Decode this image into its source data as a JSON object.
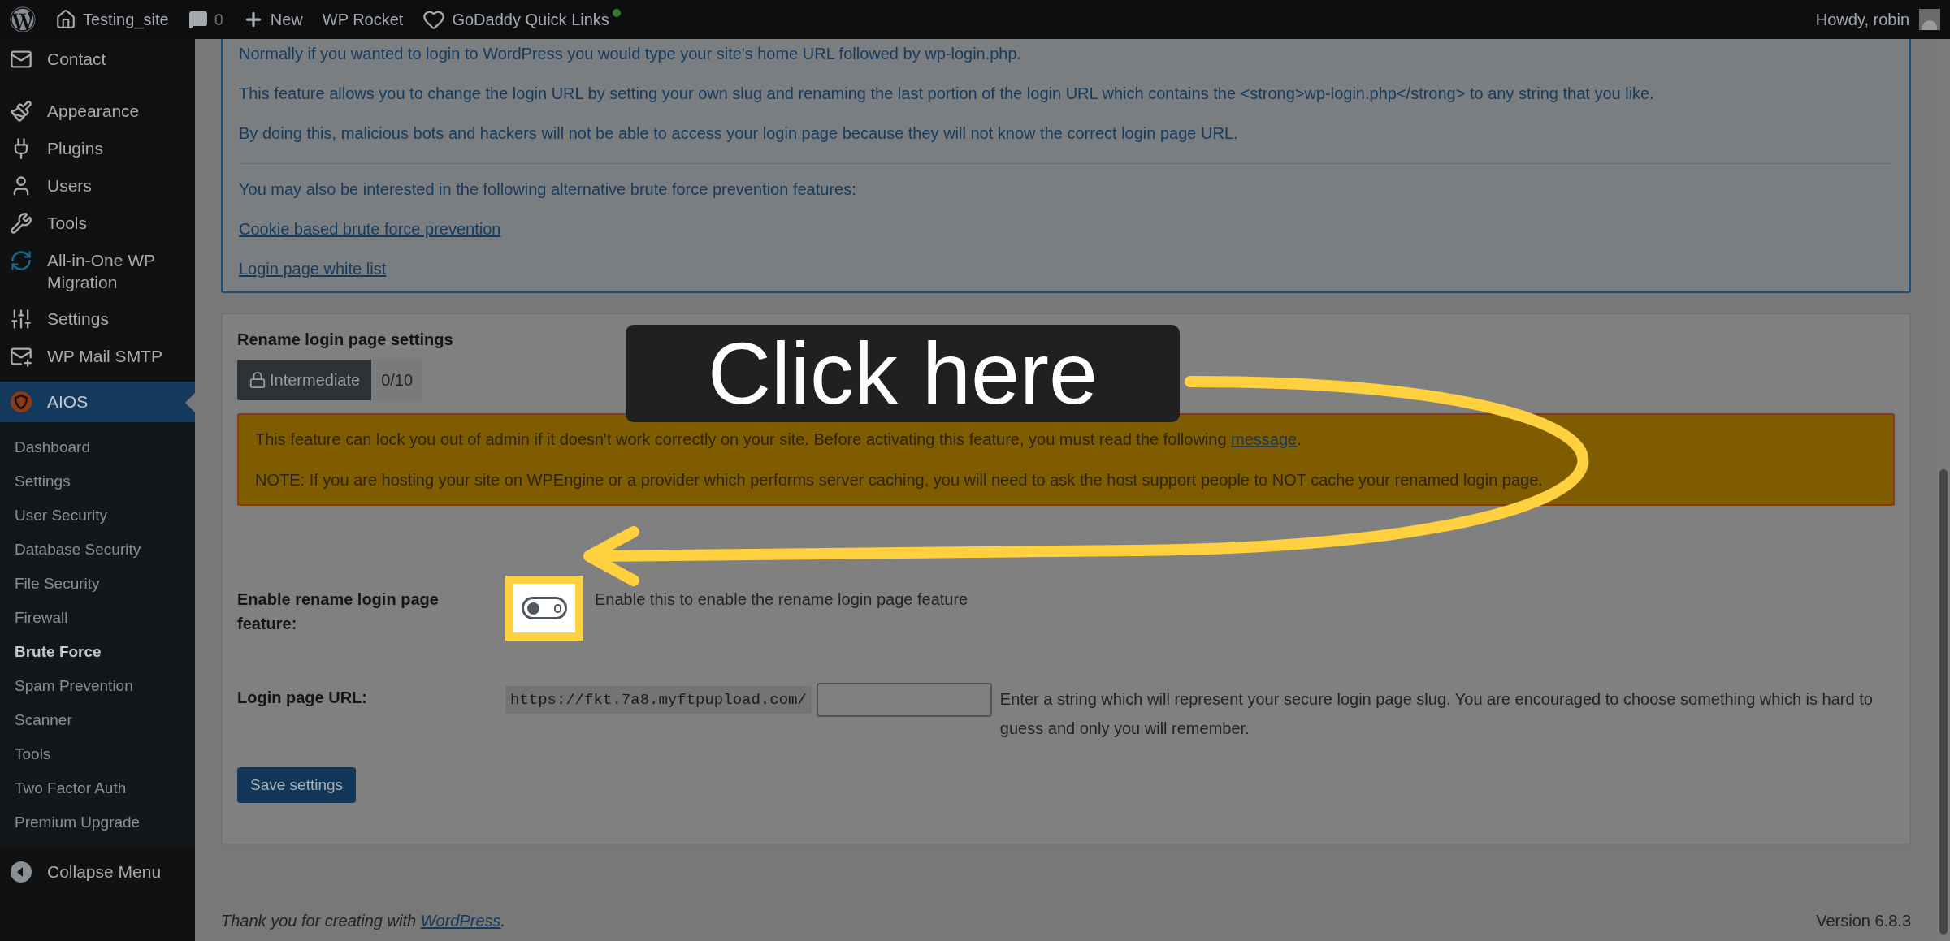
{
  "admin_bar": {
    "items": [
      {
        "kind": "logo"
      },
      {
        "kind": "site",
        "label": "Testing_site"
      },
      {
        "kind": "comments",
        "label": "0"
      },
      {
        "kind": "new",
        "label": "New"
      },
      {
        "kind": "text",
        "label": "WP Rocket"
      },
      {
        "kind": "godaddy",
        "label": "GoDaddy Quick Links"
      }
    ],
    "account": "Howdy, robin"
  },
  "sidebar": {
    "items": [
      {
        "label": "Contact",
        "selected": false
      },
      {
        "label": "Appearance",
        "selected": false
      },
      {
        "label": "Plugins",
        "selected": false
      },
      {
        "label": "Users",
        "selected": false
      },
      {
        "label": "Tools",
        "selected": false
      },
      {
        "label": "All-in-One WP Migration",
        "selected": false
      },
      {
        "label": "Settings",
        "selected": false
      },
      {
        "label": "WP Mail SMTP",
        "selected": false
      },
      {
        "label": "AIOS",
        "selected": true
      }
    ],
    "submenu": [
      {
        "label": "Dashboard",
        "selected": false
      },
      {
        "label": "Settings",
        "selected": false
      },
      {
        "label": "User Security",
        "selected": false
      },
      {
        "label": "Database Security",
        "selected": false
      },
      {
        "label": "File Security",
        "selected": false
      },
      {
        "label": "Firewall",
        "selected": false
      },
      {
        "label": "Brute Force",
        "selected": true
      },
      {
        "label": "Spam Prevention",
        "selected": false
      },
      {
        "label": "Scanner",
        "selected": false
      },
      {
        "label": "Tools",
        "selected": false
      },
      {
        "label": "Two Factor Auth",
        "selected": false
      },
      {
        "label": "Premium Upgrade",
        "selected": false
      }
    ],
    "collapse": "Collapse Menu"
  },
  "info_box": {
    "paragraphs": [
      "Normally if you wanted to login to WordPress you would type your site's home URL followed by wp-login.php.",
      "This feature allows you to change the login URL by setting your own slug and renaming the last portion of the login URL which contains the <strong>wp-login.php</strong> to any string that you like.",
      "By doing this, malicious bots and hackers will not be able to access your login page because they will not know the correct login page URL."
    ],
    "alternatives_intro": "You may also be interested in the following alternative brute force prevention features:",
    "links": [
      "Cookie based brute force prevention",
      "Login page white list"
    ]
  },
  "settings": {
    "title": "Rename login page settings",
    "badge": {
      "label": "Intermediate",
      "score": "0/10"
    },
    "warning": {
      "before": "This feature can lock you out of admin if it doesn't work correctly on your site. Before activating this feature, you must read the following ",
      "link": "message",
      "after": ".",
      "note": "NOTE: If you are hosting your site on WPEngine or a provider which performs server caching, you will need to ask the host support people to NOT cache your renamed login page."
    },
    "toggle": {
      "label": "Enable rename login page feature:",
      "on": false,
      "description": "Enable this to enable the rename login page feature"
    },
    "url": {
      "label": "Login page URL:",
      "prefix": "https://fkt.7a8.myftpupload.com/",
      "help": "Enter a string which will represent your secure login page slug. You are encouraged to choose something which is hard to guess and only you will remember."
    },
    "save": "Save settings"
  },
  "footer": {
    "before": "Thank you for creating with ",
    "link": "WordPress",
    "after": ".",
    "version": "Version 6.8.3"
  },
  "callout": {
    "text": "Click here"
  }
}
